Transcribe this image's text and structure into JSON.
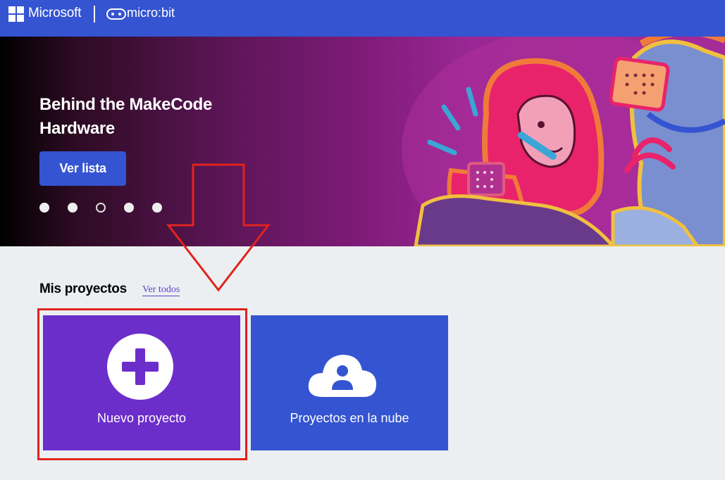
{
  "header": {
    "microsoft_label": "Microsoft",
    "microbit_label": "micro:bit",
    "microsoft_icon": "windows-logo-icon",
    "microbit_icon": "microbit-logo-icon",
    "background_color": "#3454d1"
  },
  "hero": {
    "title": "Behind the MakeCode Hardware",
    "button_label": "Ver lista",
    "carousel": {
      "total": 5,
      "active_index": 2
    }
  },
  "projects": {
    "section_title": "Mis proyectos",
    "see_all_label": "Ver todos",
    "cards": [
      {
        "label": "Nuevo proyecto",
        "icon": "plus-icon",
        "color": "#6c2ecb"
      },
      {
        "label": "Proyectos en la nube",
        "icon": "cloud-user-icon",
        "color": "#3454d1"
      }
    ]
  },
  "annotations": {
    "highlight_color": "#e0231e"
  }
}
